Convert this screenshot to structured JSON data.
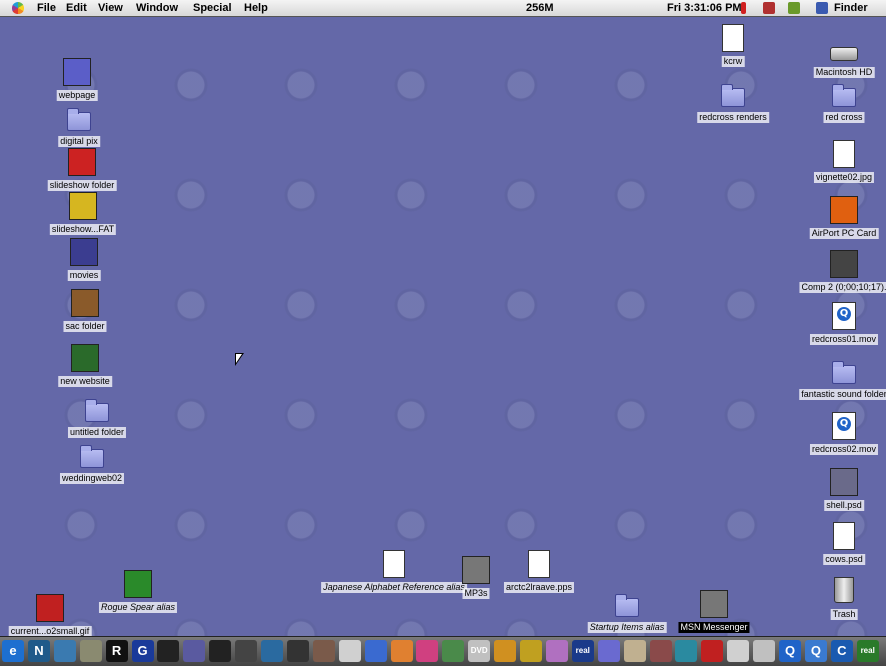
{
  "menubar": {
    "menus": [
      "File",
      "Edit",
      "View",
      "Window",
      "Special",
      "Help"
    ],
    "memory": "256M",
    "clock": "Fri 3:31:06 PM",
    "app": "Finder"
  },
  "desktop_left": [
    {
      "label": "webpage",
      "icon": "photo-icon",
      "color": "#5b5ec8"
    },
    {
      "label": "digital pix",
      "icon": "folder-icon"
    },
    {
      "label": "slideshow folder",
      "icon": "drill-icon",
      "color": "#cc2222"
    },
    {
      "label": "slideshow...FAT",
      "icon": "drill-icon",
      "color": "#d6b620"
    },
    {
      "label": "movies",
      "icon": "photo-icon",
      "color": "#3b3d90"
    },
    {
      "label": "sac folder",
      "icon": "photo-icon",
      "color": "#8a5a2a"
    },
    {
      "label": "new website",
      "icon": "photo-icon",
      "color": "#2a6a2a"
    },
    {
      "label": "untitled folder",
      "icon": "folder-icon"
    },
    {
      "label": "weddingweb02",
      "icon": "folder-icon"
    }
  ],
  "desktop_right": [
    {
      "label": "kcrw",
      "icon": "document-icon"
    },
    {
      "label": "Macintosh HD",
      "icon": "hard-disk-icon"
    },
    {
      "label": "redcross renders",
      "icon": "folder-icon"
    },
    {
      "label": "red cross",
      "icon": "folder-icon"
    },
    {
      "label": "vignette02.jpg",
      "icon": "image-file-icon"
    },
    {
      "label": "AirPort PC Card",
      "icon": "airport-card-icon",
      "color": "#e06010"
    },
    {
      "label": "Comp 2 (0;00;10;17).",
      "icon": "photo-icon",
      "color": "#444444"
    },
    {
      "label": "redcross01.mov",
      "icon": "quicktime-movie-icon"
    },
    {
      "label": "fantastic sound folder",
      "icon": "folder-icon"
    },
    {
      "label": "redcross02.mov",
      "icon": "quicktime-movie-icon"
    },
    {
      "label": "shell.psd",
      "icon": "photo-icon",
      "color": "#6a6a8a"
    },
    {
      "label": "cows.psd",
      "icon": "document-icon"
    },
    {
      "label": "Trash",
      "icon": "trash-icon"
    }
  ],
  "desktop_bottom": [
    {
      "label": "Rogue Spear alias",
      "icon": "photo-icon",
      "color": "#2a8a2a",
      "alias": true
    },
    {
      "label": "current...o2small.gif",
      "icon": "photo-icon",
      "color": "#c02020"
    },
    {
      "label": "Japanese Alphabet Reference alias",
      "icon": "document-icon",
      "alias": true
    },
    {
      "label": "MP3s",
      "icon": "photo-icon",
      "color": "#777777"
    },
    {
      "label": "arctc2lraave.pps",
      "icon": "document-icon"
    },
    {
      "label": "Startup Items alias",
      "icon": "folder-icon",
      "alias": true
    },
    {
      "label": "MSN Messenger",
      "icon": "msn-messenger-icon",
      "selected": true
    }
  ],
  "launcher": {
    "items": [
      {
        "name": "ie-icon",
        "color": "#1d6fd0",
        "text": "e"
      },
      {
        "name": "netscape-icon",
        "color": "#1f5a8a",
        "text": "N"
      },
      {
        "name": "app-icon",
        "color": "#3a7ab0",
        "text": ""
      },
      {
        "name": "scanner-icon",
        "color": "#8a8a70",
        "text": ""
      },
      {
        "name": "realbasic-icon",
        "color": "#111111",
        "text": "R"
      },
      {
        "name": "golive-icon",
        "color": "#1a3a9a",
        "text": "G"
      },
      {
        "name": "app-icon",
        "color": "#222222",
        "text": ""
      },
      {
        "name": "app-icon",
        "color": "#5a5aa0",
        "text": ""
      },
      {
        "name": "film-icon",
        "color": "#222222",
        "text": ""
      },
      {
        "name": "film-icon",
        "color": "#444444",
        "text": ""
      },
      {
        "name": "eye-icon",
        "color": "#2a6aa0",
        "text": ""
      },
      {
        "name": "eye-icon",
        "color": "#333333",
        "text": ""
      },
      {
        "name": "app-icon",
        "color": "#7a5a4a",
        "text": ""
      },
      {
        "name": "app-icon",
        "color": "#d0d0d0",
        "text": ""
      },
      {
        "name": "app-icon",
        "color": "#3a6ad0",
        "text": ""
      },
      {
        "name": "app-icon",
        "color": "#e08030",
        "text": ""
      },
      {
        "name": "app-icon",
        "color": "#d04080",
        "text": ""
      },
      {
        "name": "phone-icon",
        "color": "#4a8a4a",
        "text": ""
      },
      {
        "name": "dvd-icon",
        "color": "#c0c0c0",
        "text": "DVD"
      },
      {
        "name": "app-icon",
        "color": "#d09020",
        "text": ""
      },
      {
        "name": "app-icon",
        "color": "#c0a020",
        "text": ""
      },
      {
        "name": "itunes-icon",
        "color": "#b070c0",
        "text": ""
      },
      {
        "name": "real-icon",
        "color": "#1a3a8a",
        "text": "real"
      },
      {
        "name": "app-icon",
        "color": "#6a6ad0",
        "text": ""
      },
      {
        "name": "app-icon",
        "color": "#c0b090",
        "text": ""
      },
      {
        "name": "app-icon",
        "color": "#8a4a4a",
        "text": ""
      },
      {
        "name": "app-icon",
        "color": "#2a8aa0",
        "text": ""
      },
      {
        "name": "download-icon",
        "color": "#c02020",
        "text": ""
      },
      {
        "name": "app-icon",
        "color": "#d0d0d0",
        "text": ""
      },
      {
        "name": "app-icon",
        "color": "#c0c0c0",
        "text": ""
      },
      {
        "name": "quicktime-icon",
        "color": "#1f63c8",
        "text": "Q"
      },
      {
        "name": "quicktime-icon",
        "color": "#3a7ad0",
        "text": "Q"
      },
      {
        "name": "app-icon",
        "color": "#1a5ab0",
        "text": "C"
      },
      {
        "name": "real-icon",
        "color": "#2a7a2a",
        "text": "real"
      }
    ]
  },
  "colors": {
    "desktop": "#6468a8",
    "menubar": "#e6e6e6"
  }
}
